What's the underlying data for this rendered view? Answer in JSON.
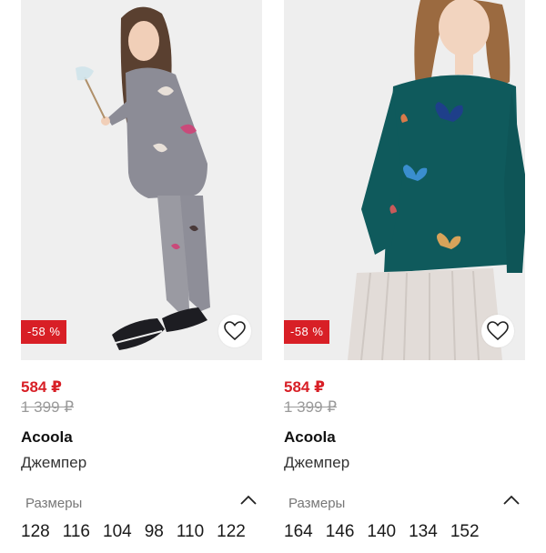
{
  "products": [
    {
      "discount_badge": "-58 %",
      "price_new": "584 ₽",
      "price_old": "1 399 ₽",
      "brand": "Acoola",
      "name": "Джемпер",
      "sizes_label": "Размеры",
      "sizes": [
        "128",
        "116",
        "104",
        "98",
        "110",
        "122"
      ],
      "favorite_icon": "heart-outline-icon",
      "toggle_icon": "chevron-up-icon"
    },
    {
      "discount_badge": "-58 %",
      "price_new": "584 ₽",
      "price_old": "1 399 ₽",
      "brand": "Acoola",
      "name": "Джемпер",
      "sizes_label": "Размеры",
      "sizes": [
        "164",
        "146",
        "140",
        "134",
        "152"
      ],
      "favorite_icon": "heart-outline-icon",
      "toggle_icon": "chevron-up-icon"
    }
  ],
  "colors": {
    "discount_red": "#d81f26",
    "old_price_gray": "#9a9a9a",
    "photo_background": "#ededed"
  }
}
